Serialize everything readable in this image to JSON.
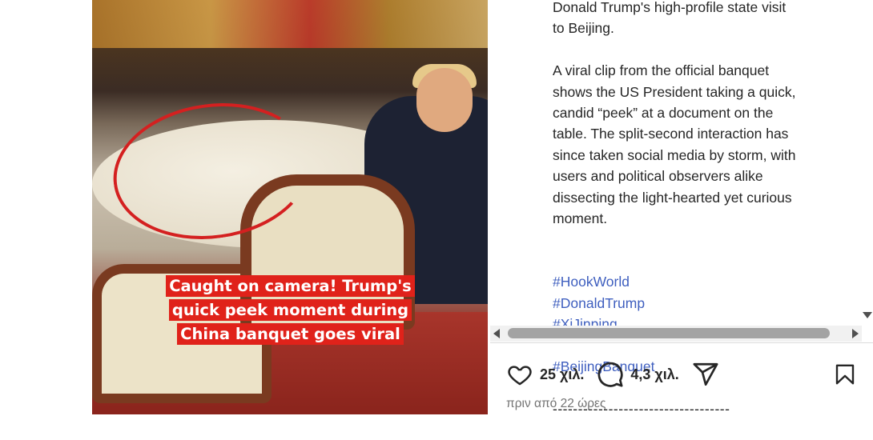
{
  "media": {
    "caption_lines": [
      "Caught on camera! Trump's",
      "quick peek moment during",
      "China banquet goes viral"
    ]
  },
  "post": {
    "para1": "Donald Trump's high-profile state visit\nto Beijing.",
    "para2": "A viral clip from the official banquet\nshows the US President taking a quick,\ncandid “peek” at a document on the\ntable. The split-second interaction has\nsince taken social media by storm, with\nusers and political observers alike\ndissecting the light-hearted yet curious\nmoment.",
    "hashtags": [
      "#HookWorld",
      "#DonaldTrump",
      "#XiJinping",
      "#BeijingBanquet"
    ],
    "dashes": "-----------------------------------"
  },
  "actions": {
    "likes": "25 χιλ.",
    "comments": "4,3 χιλ.",
    "icons": [
      "heart-icon",
      "comment-icon",
      "share-icon",
      "bookmark-icon"
    ]
  },
  "time_ago": "πριν από 22 ώρες"
}
